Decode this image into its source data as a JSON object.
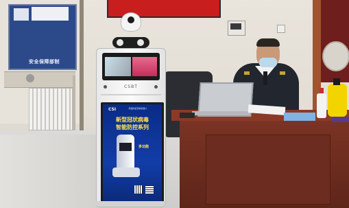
{
  "scene": {
    "wall_sign_text": "安全保障部制",
    "robot_brand": "CSBT",
    "screen_logo": "CSI",
    "screen_top_text": "测温防疫智能机器人",
    "screen_title_line1": "新型冠状病毒",
    "screen_title_line2": "智能防控系列",
    "screen_side_badge": "多功能",
    "colors": {
      "wall": "#e6e1d8",
      "floor": "#d6d4d2",
      "desk": "#7a3324",
      "uniform": "#22262e",
      "screen_blue": "#0c2e8a",
      "red_panel": "#c81e1e",
      "laptop": "#c9cdd2",
      "bottle_yellow": "#f2d400"
    }
  }
}
